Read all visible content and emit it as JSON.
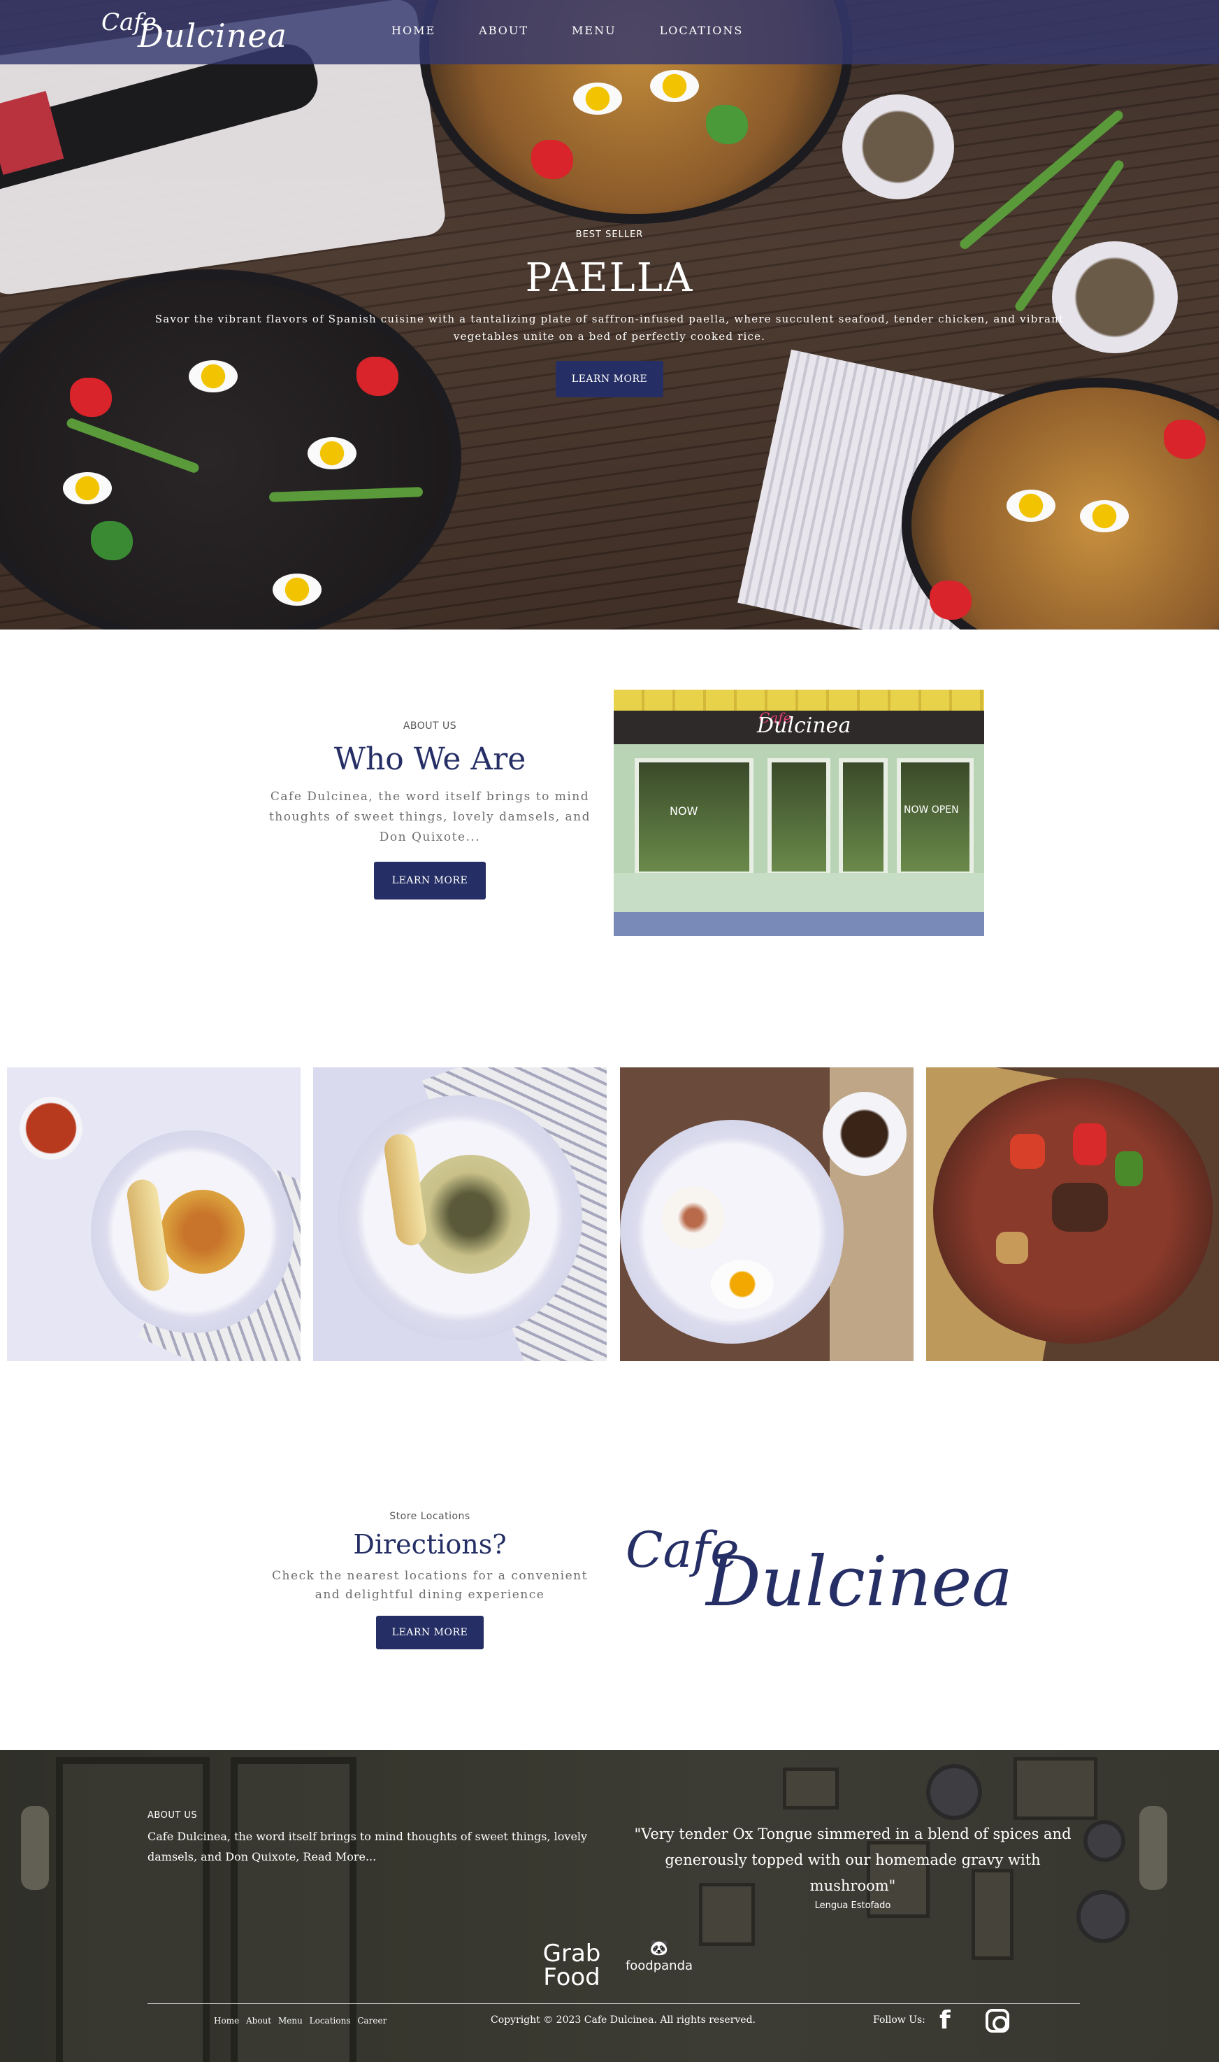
{
  "brand": {
    "logo_cafe": "Cafe",
    "logo_name": "Dulcinea"
  },
  "nav": {
    "items": [
      "HOME",
      "ABOUT",
      "MENU",
      "LOCATIONS"
    ]
  },
  "hero": {
    "kicker": "BEST SELLER",
    "title": "PAELLA",
    "description": "Savor the vibrant flavors of Spanish cuisine with a tantalizing plate of saffron-infused paella, where succulent seafood, tender chicken, and vibrant vegetables unite on a bed of perfectly cooked rice.",
    "button": "LEARN MORE"
  },
  "about": {
    "kicker": "ABOUT US",
    "title": "Who We Are",
    "text": "Cafe Dulcinea, the word itself brings to mind thoughts of sweet things, lovely damsels, and Don Quixote...",
    "button": "LEARN MORE",
    "storefront_sign_cafe": "Cafe",
    "storefront_sign_name": "Dulcinea",
    "storefront_window_left": "NOW",
    "storefront_window_right": "NOW OPEN"
  },
  "directions": {
    "kicker": "Store Locations",
    "title": "Directions?",
    "text": "Check the nearest locations for a convenient and delightful dining experience",
    "button": "LEARN MORE",
    "logo_cafe": "Cafe",
    "logo_name": "Dulcinea"
  },
  "footer": {
    "about_kicker": "ABOUT US",
    "about_text": "Cafe Dulcinea, the word itself brings to mind thoughts of sweet things, lovely damsels, and Don Quixote, Read More...",
    "quote": "\"Very tender Ox Tongue simmered in a blend of spices and generously topped with our homemade gravy with mushroom\"",
    "quote_attribution": "Lengua Estofado",
    "grab_line1": "Grab",
    "grab_line2": "Food",
    "foodpanda": "foodpanda",
    "links": [
      "Home",
      "About",
      "Menu",
      "Locations",
      "Career"
    ],
    "copyright": "Copyright © 2023 Cafe Dulcinea. All rights reserved.",
    "follow_label": "Follow Us:",
    "facebook_glyph": "f"
  },
  "colors": {
    "accent": "#262f65",
    "nav_bg": "#34386e"
  },
  "icons": [
    "facebook-icon",
    "instagram-icon",
    "foodpanda-icon"
  ]
}
